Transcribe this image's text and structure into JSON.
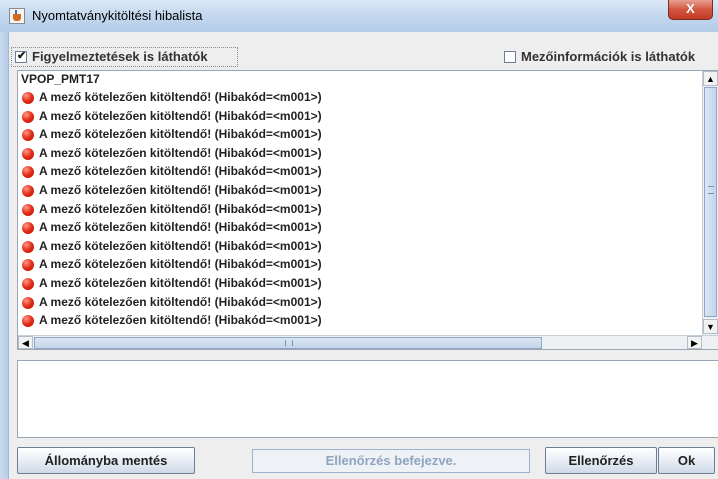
{
  "window": {
    "title": "Nyomtatványkitöltési hibalista",
    "close_label": "X"
  },
  "options": {
    "warnings_label": "Figyelmeztetések is láthatók",
    "warnings_checked": true,
    "fieldinfo_label": "Mezőinformációk is láthatók",
    "fieldinfo_checked": false
  },
  "list": {
    "header": "VPOP_PMT17",
    "rows": [
      "A mező kötelezően kitöltendő! (Hibakód=<m001>)",
      "A mező kötelezően kitöltendő! (Hibakód=<m001>)",
      "A mező kötelezően kitöltendő! (Hibakód=<m001>)",
      "A mező kötelezően kitöltendő! (Hibakód=<m001>)",
      "A mező kötelezően kitöltendő! (Hibakód=<m001>)",
      "A mező kötelezően kitöltendő! (Hibakód=<m001>)",
      "A mező kötelezően kitöltendő! (Hibakód=<m001>)",
      "A mező kötelezően kitöltendő! (Hibakód=<m001>)",
      "A mező kötelezően kitöltendő! (Hibakód=<m001>)",
      "A mező kötelezően kitöltendő! (Hibakód=<m001>)",
      "A mező kötelezően kitöltendő! (Hibakód=<m001>)",
      "A mező kötelezően kitöltendő! (Hibakód=<m001>)",
      "A mező kötelezően kitöltendő! (Hibakód=<m001>)"
    ],
    "row_icon": "error-red-dot-icon"
  },
  "buttons": {
    "save_to_file": "Állományba mentés",
    "status": "Ellenőrzés befejezve.",
    "check": "Ellenőrzés",
    "ok": "Ok"
  },
  "colors": {
    "error_dot": "#e52a16",
    "status_text": "#8fa4bf",
    "close_button": "#d2563f"
  }
}
